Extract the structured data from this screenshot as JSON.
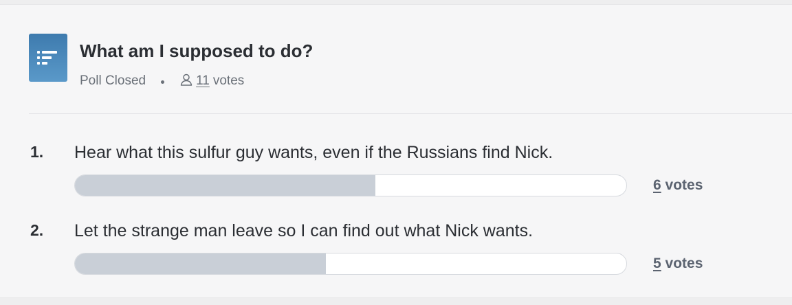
{
  "poll": {
    "title": "What am I supposed to do?",
    "status": "Poll Closed",
    "voters_count": "11",
    "voters_suffix": "votes",
    "icon": "poll-list-icon",
    "accent_color": "#4a88bb"
  },
  "options": [
    {
      "number": "1.",
      "text": "Hear what this sulfur guy wants, even if the Russians find Nick.",
      "votes": "6",
      "votes_suffix": "votes",
      "percent": 54.5
    },
    {
      "number": "2.",
      "text": "Let the strange man leave so I can find out what Nick wants.",
      "votes": "5",
      "votes_suffix": "votes",
      "percent": 45.5
    }
  ]
}
